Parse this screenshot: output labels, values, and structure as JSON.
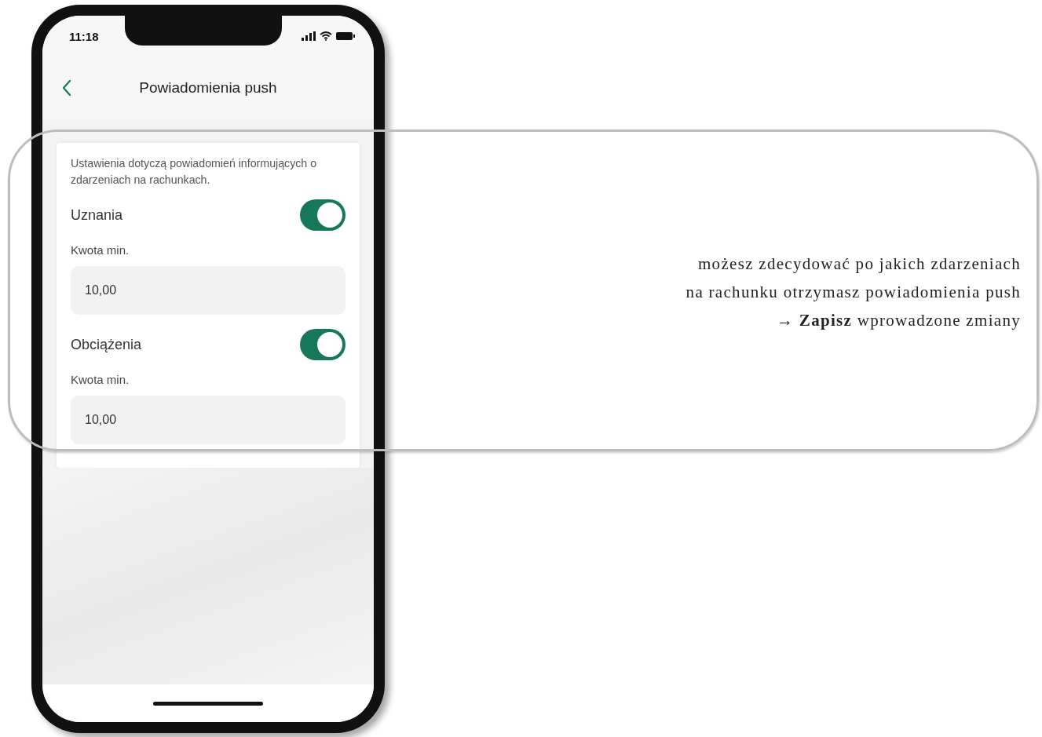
{
  "status_bar": {
    "time": "11:18"
  },
  "header": {
    "title": "Powiadomienia push"
  },
  "description": "Ustawienia dotyczą powiadomień informujących o zdarzeniach na rachunkach.",
  "settings": [
    {
      "label": "Uznania",
      "on": true,
      "amount_label": "Kwota min.",
      "amount_value": "10,00"
    },
    {
      "label": "Obciążenia",
      "on": true,
      "amount_label": "Kwota min.",
      "amount_value": "10,00"
    }
  ],
  "annotation": {
    "lines": [
      "możesz zdecydować po jakich zdarzeniach",
      "na rachunku otrzymasz powiadomienia push",
      "→ **Zapisz** wprowadzone zmiany"
    ]
  }
}
